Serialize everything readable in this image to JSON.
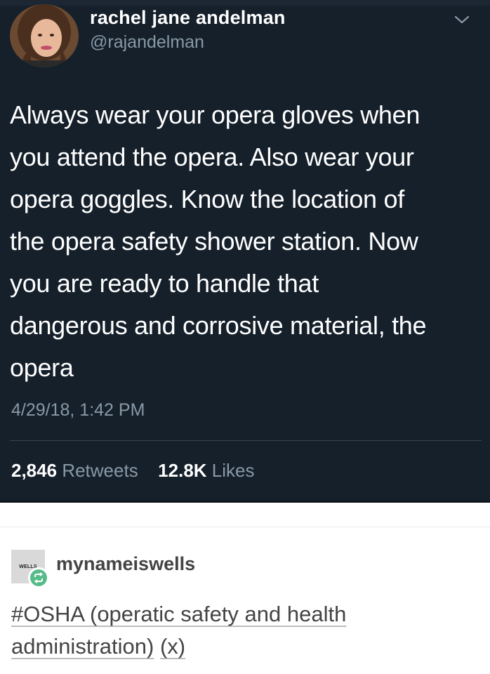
{
  "tweet": {
    "display_name": "rachel jane andelman",
    "handle": "@rajandelman",
    "text_lines": [
      "Always wear your opera gloves when",
      "you attend the opera. Also wear your",
      "opera goggles. Know the location of",
      "the opera safety shower station. Now",
      "you are ready to handle that",
      "dangerous and corrosive material, the",
      "opera"
    ],
    "timestamp": "4/29/18, 1:42 PM",
    "retweet_count": "2,846",
    "retweet_label": "Retweets",
    "like_count": "12.8K",
    "like_label": "Likes"
  },
  "tumblr": {
    "blog_name": "mynameiswells",
    "avatar_text": "WELLS",
    "post_link_line1": "#OSHA (operatic safety and health",
    "post_link_line2": "administration)",
    "post_source": "(x)"
  },
  "icons": {
    "menu": "chevron-down-icon",
    "reblog": "reblog-icon"
  },
  "colors": {
    "tweet_background": "#15202b",
    "tweet_text": "#ffffff",
    "muted_text": "#8899a6",
    "reblog_green": "#56bc8a",
    "tumblr_text": "#444444"
  }
}
